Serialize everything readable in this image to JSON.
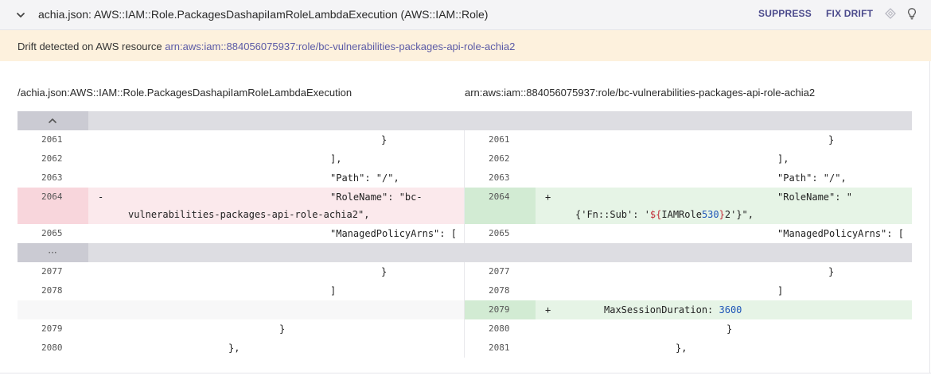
{
  "header": {
    "title": "achia.json: AWS::IAM::Role.PackagesDashapiIamRoleLambdaExecution (AWS::IAM::Role)",
    "suppress_label": "SUPPRESS",
    "fix_drift_label": "FIX DRIFT",
    "icons": [
      "chevron-down-icon",
      "diamond-icon",
      "lightbulb-icon"
    ]
  },
  "alert": {
    "text": "Drift detected on AWS resource",
    "arn": "arn:aws:iam::884056075937:role/bc-vulnerabilities-packages-api-role-achia2"
  },
  "diff": {
    "left_path": "/achia.json:AWS::IAM::Role.PackagesDashapiIamRoleLambdaExecution",
    "right_path": "arn:aws:iam::884056075937:role/bc-vulnerabilities-packages-api-role-achia2",
    "expand_up_icon": "chevron-up-icon",
    "collapsed_icon": "ellipsis-icon",
    "ellipsis": "···",
    "block1": {
      "r2061": {
        "left_num": "2061",
        "left_code": "}",
        "right_num": "2061",
        "right_code": "}"
      },
      "r2062": {
        "left_num": "2062",
        "left_code": "],",
        "right_num": "2062",
        "right_code": "],"
      },
      "r2063": {
        "left_num": "2063",
        "left_code": "\"Path\": \"/\",",
        "right_num": "2063",
        "right_code": "\"Path\": \"/\","
      },
      "r2064": {
        "left_num": "2064",
        "left_sign": "-",
        "left_code_1": "\"RoleName\": \"bc-",
        "left_code_2": "vulnerabilities-packages-api-role-achia2\",",
        "right_num": "2064",
        "right_sign": "+",
        "right_code_1": "\"RoleName\": \"",
        "right_code_2_a": "{'Fn::Sub': '",
        "right_code_2_b": "${",
        "right_code_2_c": "IAMRole",
        "right_code_2_d": "530",
        "right_code_2_e": "}",
        "right_code_2_f": "2'}\","
      },
      "r2065": {
        "left_num": "2065",
        "left_code": "\"ManagedPolicyArns\": [",
        "right_num": "2065",
        "right_code": "\"ManagedPolicyArns\": ["
      }
    },
    "block2": {
      "r2077": {
        "left_num": "2077",
        "left_code": "}",
        "right_num": "2077",
        "right_code": "}"
      },
      "r2078": {
        "left_num": "2078",
        "left_code": "]",
        "right_num": "2078",
        "right_code": "]"
      },
      "r_added": {
        "right_num": "2079",
        "right_sign": "+",
        "right_code_a": "MaxSessionDuration: ",
        "right_code_b": "3600"
      },
      "r2079": {
        "left_num": "2079",
        "left_code": "}",
        "right_num": "2080",
        "right_code": "}"
      },
      "r2080": {
        "left_num": "2080",
        "left_code": "},",
        "right_num": "2081",
        "right_code": "},"
      }
    }
  },
  "colors": {
    "header_bg": "#f4f4f6",
    "alert_bg": "#fdf1dd",
    "link": "#5b5aa6",
    "action": "#4b4a8c",
    "deleted_bg": "#fbe9ec",
    "added_bg": "#e6f4e6"
  }
}
